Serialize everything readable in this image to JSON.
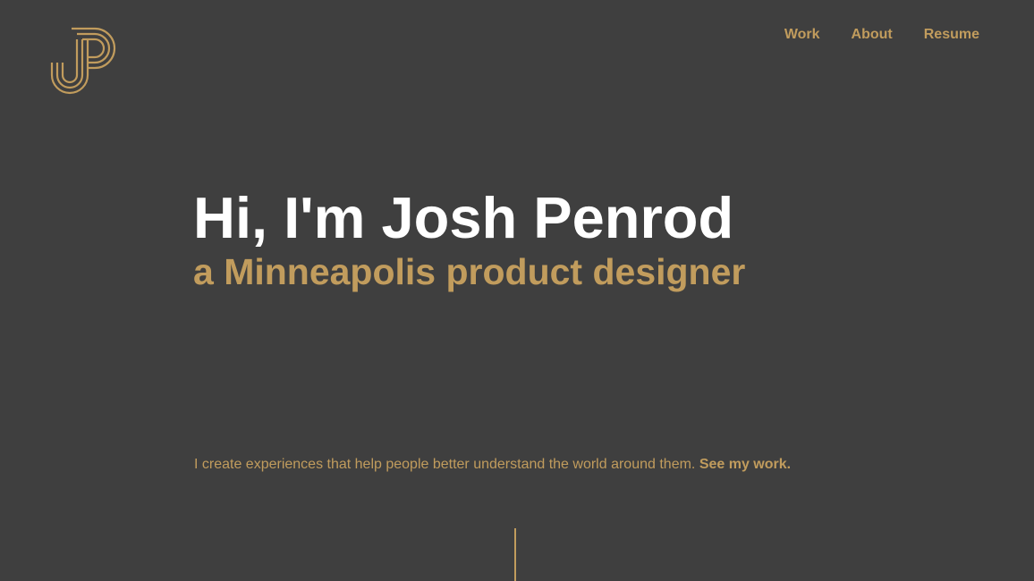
{
  "brand": {
    "logo_icon": "jp-monogram-icon",
    "accent_color": "#c19c5d",
    "background_color": "#3f3f3f",
    "heading_color": "#ffffff"
  },
  "nav": {
    "items": [
      {
        "label": "Work"
      },
      {
        "label": "About"
      },
      {
        "label": "Resume"
      }
    ]
  },
  "hero": {
    "title": "Hi, I'm Josh Penrod",
    "subtitle": "a Minneapolis product designer"
  },
  "intro": {
    "text": "I create experiences that help people better understand the world around them.",
    "link_label": "See my work."
  },
  "scroll_indicator": {
    "icon": "scroll-down-line-icon"
  }
}
